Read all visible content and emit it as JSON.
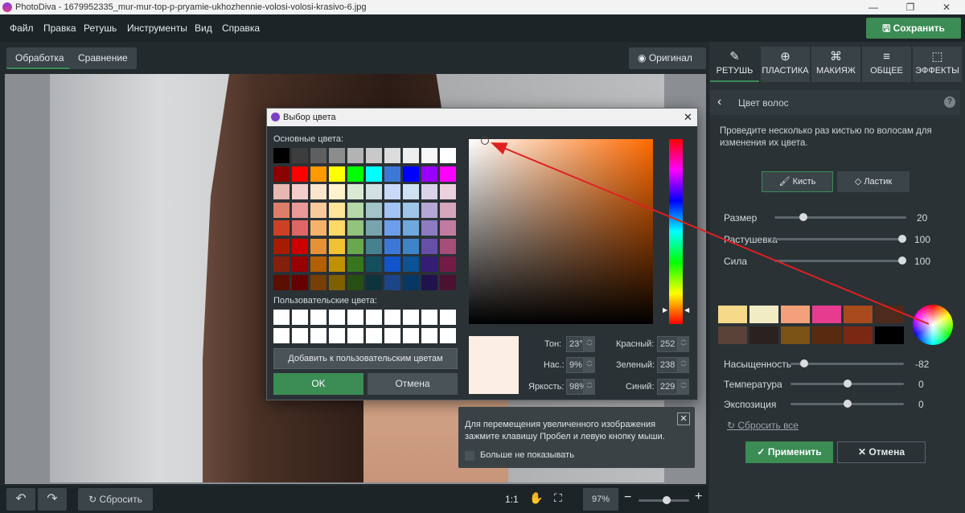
{
  "window": {
    "title": "PhotoDiva - 1679952335_mur-mur-top-p-pryamie-ukhozhennie-volosi-volosi-krasivo-6.jpg",
    "minimize": "—",
    "maximize": "❐",
    "close": "✕"
  },
  "menu": [
    "Файл",
    "Правка",
    "Ретушь",
    "Инструменты",
    "Вид",
    "Справка"
  ],
  "save_label": "Сохранить",
  "view_tabs": {
    "processing": "Обработка",
    "compare": "Сравнение",
    "original": "Оригинал"
  },
  "bottom": {
    "reset": "Сбросить",
    "ratio": "1:1",
    "zoom": "97%",
    "zoom_level": 0.56
  },
  "right_tabs": [
    {
      "label": "РЕТУШЬ",
      "icon": "✎"
    },
    {
      "label": "ПЛАСТИКА",
      "icon": "⊕"
    },
    {
      "label": "МАКИЯЖ",
      "icon": "⌘"
    },
    {
      "label": "ОБЩЕЕ",
      "icon": "≡"
    },
    {
      "label": "ЭФФЕКТЫ",
      "icon": "⬚"
    }
  ],
  "panel": {
    "title": "Цвет волос",
    "help": "?",
    "description": "Проведите несколько раз кистью по волосам для изменения их цвета.",
    "brush": "Кисть",
    "eraser": "Ластик",
    "sliders": [
      {
        "label": "Размер",
        "value": "20",
        "level": 0.2
      },
      {
        "label": "Растушевка",
        "value": "100",
        "level": 1
      },
      {
        "label": "Сила",
        "value": "100",
        "level": 1
      }
    ],
    "presets": [
      "#f7d98a",
      "#f1ecc4",
      "#f4a07a",
      "#e63b8e",
      "#a94a1c",
      "#4d2a1c",
      "#5a4238",
      "#2b2220",
      "#7a5216",
      "#5a2a10",
      "#7a2814",
      "#000000"
    ],
    "adjust": [
      {
        "label": "Насыщенность",
        "value": "-82",
        "level": 0.09
      },
      {
        "label": "Температура",
        "value": "0",
        "level": 0.5
      },
      {
        "label": "Экспозиция",
        "value": "0",
        "level": 0.5
      }
    ],
    "reset_all": "Сбросить все",
    "apply": "Применить",
    "cancel": "Отмена"
  },
  "dialog": {
    "title": "Выбор цвета",
    "basic_label": "Основные цвета:",
    "custom_label": "Пользовательские цвета:",
    "add_custom": "Добавить к пользовательским цветам",
    "ok": "OK",
    "cancel": "Отмена",
    "hue_label": "Тон:",
    "hue": "23°",
    "sat_label": "Нас.:",
    "sat": "9%",
    "val_label": "Яркость:",
    "val": "98%",
    "red_label": "Красный:",
    "red": "252",
    "green_label": "Зеленый:",
    "green": "238",
    "blue_label": "Синий:",
    "blue": "229",
    "selected_color": "#fceee5",
    "basic_colors": [
      [
        "#000000",
        "#3d3d3d",
        "#5f5f5f",
        "#8c8c8c",
        "#b3b3b3",
        "#c9c9c9",
        "#dcdcdc",
        "#eeeeee",
        "#f7f7f7",
        "#ffffff"
      ],
      [
        "#8b0000",
        "#ff0000",
        "#ff9900",
        "#ffff00",
        "#00ff00",
        "#00ffff",
        "#3c78d8",
        "#0000ff",
        "#9900ff",
        "#ff00ff"
      ],
      [
        "#e6b8af",
        "#f4cccc",
        "#fce5cd",
        "#fff2cc",
        "#d9ead3",
        "#d0e0e3",
        "#c9daf8",
        "#cfe2f3",
        "#d9d2e9",
        "#ead1dc"
      ],
      [
        "#dd7e6b",
        "#ea9999",
        "#f9cb9c",
        "#ffe599",
        "#b6d7a8",
        "#a2c4c9",
        "#a4c2f4",
        "#9fc5e8",
        "#b4a7d6",
        "#d5a6bd"
      ],
      [
        "#cc4125",
        "#e06666",
        "#f6b26b",
        "#ffd966",
        "#93c47d",
        "#76a5af",
        "#6d9eeb",
        "#6fa8dc",
        "#8e7cc3",
        "#c27ba0"
      ],
      [
        "#a61c00",
        "#cc0000",
        "#e69138",
        "#f1c232",
        "#6aa84f",
        "#45818e",
        "#3c78d8",
        "#3d85c6",
        "#674ea7",
        "#a64d79"
      ],
      [
        "#85200c",
        "#990000",
        "#b45f06",
        "#bf9000",
        "#38761d",
        "#134f5c",
        "#1155cc",
        "#0b5394",
        "#351c75",
        "#741b47"
      ],
      [
        "#5b0f00",
        "#660000",
        "#783f04",
        "#7f6000",
        "#274e13",
        "#0c343d",
        "#1c4587",
        "#073763",
        "#20124d",
        "#4c1130"
      ]
    ]
  },
  "toast": {
    "text": "Для перемещения увеличенного изображения зажмите клавишу Пробел и левую кнопку мыши.",
    "dont_show": "Больше не показывать",
    "close": "✕"
  }
}
